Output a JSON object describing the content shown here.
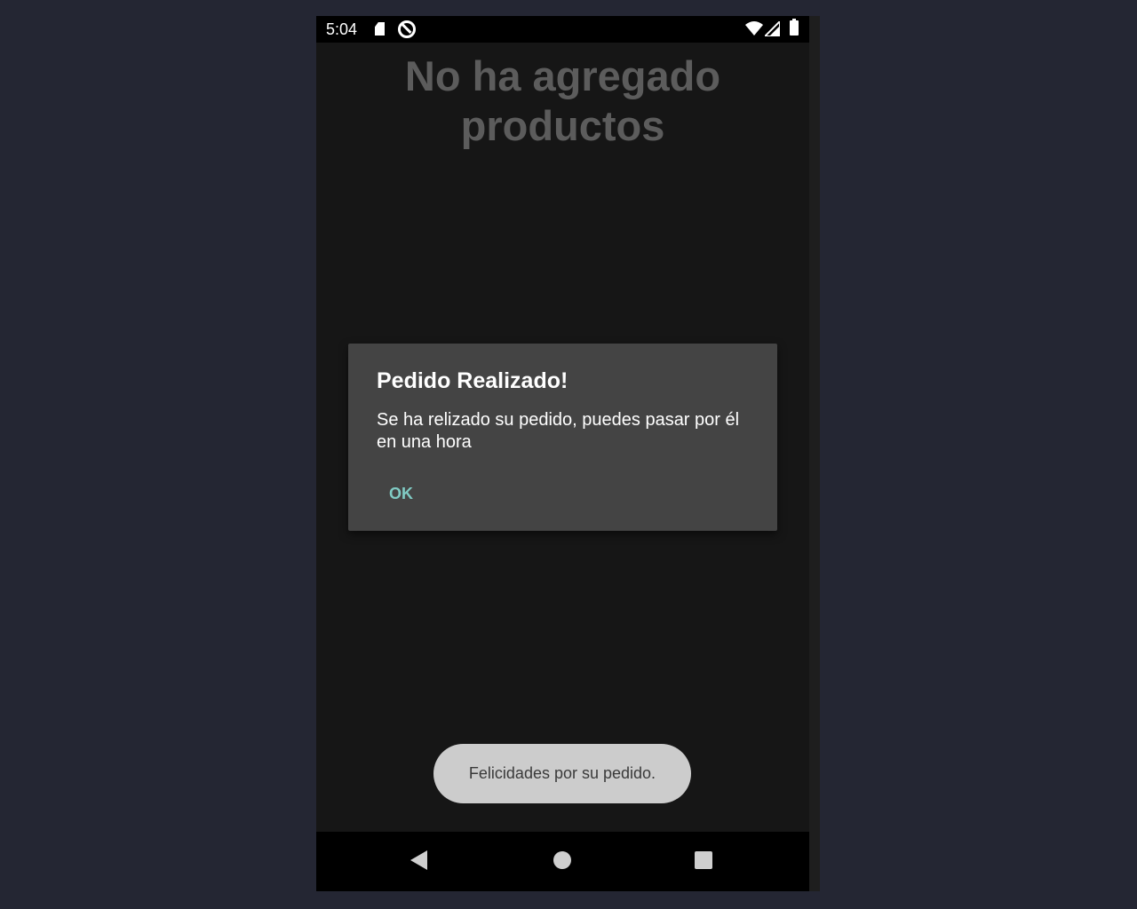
{
  "status_bar": {
    "time": "5:04",
    "icons": [
      "sd-card-icon",
      "sync-ring-icon",
      "wifi-icon",
      "cell-signal-icon",
      "battery-icon"
    ]
  },
  "main": {
    "empty_message": "No ha agregado productos"
  },
  "dialog": {
    "title": "Pedido Realizado!",
    "message": "Se ha relizado su pedido, puedes pasar por él en una hora",
    "ok_label": "OK",
    "ok_color": "#80cbc4"
  },
  "toast": {
    "text": "Felicidades por su pedido."
  },
  "nav_bar": {
    "icons": [
      "back-icon",
      "home-icon",
      "recents-icon"
    ]
  },
  "colors": {
    "background": "#242633",
    "app_background": "#161616",
    "dialog_background": "#444444",
    "toast_background": "#cccccc"
  }
}
